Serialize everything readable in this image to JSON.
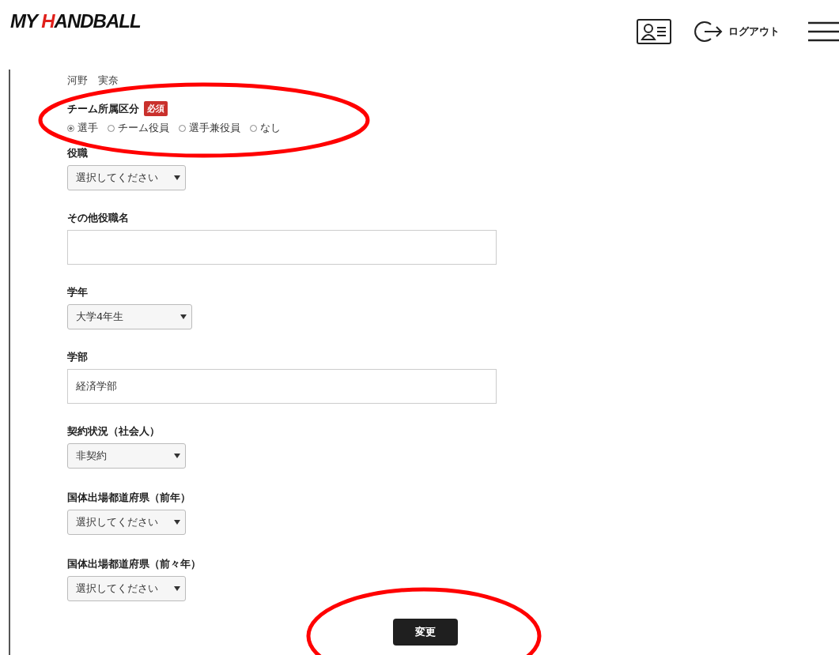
{
  "header": {
    "logo": [
      {
        "text": "MY ",
        "color": "#111111"
      },
      {
        "text": "H",
        "color": "#e0201b"
      },
      {
        "text": "ANDBALL",
        "color": "#111111"
      }
    ],
    "logout": "ログアウト"
  },
  "name": "河野　実奈",
  "fields": [
    {
      "kind": "radio",
      "label": "チーム所属区分",
      "badge": "必須",
      "circled": true,
      "options": [
        {
          "label": "選手",
          "selected": true
        },
        {
          "label": "チーム役員",
          "selected": false
        },
        {
          "label": "選手兼役員",
          "selected": false
        },
        {
          "label": "なし",
          "selected": false
        }
      ]
    },
    {
      "kind": "select",
      "label": "役職",
      "value": "選択してください"
    },
    {
      "kind": "text",
      "label": "その他役職名"
    },
    {
      "kind": "select",
      "label": "学年",
      "value": "大学4年生"
    },
    {
      "kind": "text",
      "label": "学部",
      "value": "経済学部"
    },
    {
      "kind": "select",
      "label": "契約状況（社会人）",
      "value": "非契約"
    },
    {
      "kind": "select",
      "label": "国体出場都道府県（前年）",
      "value": "選択してください"
    },
    {
      "kind": "select",
      "label": "国体出場都道府県（前々年）",
      "value": "選択してください"
    }
  ],
  "submit": {
    "label": "変更",
    "circled": true
  }
}
